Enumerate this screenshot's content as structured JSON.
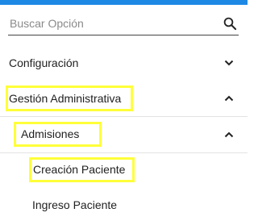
{
  "theme": {
    "accent": "#1e88e5",
    "highlight": "#ffff3a",
    "text": "#212121",
    "placeholder": "#8a8a8a"
  },
  "search": {
    "placeholder": "Buscar Opción",
    "value": "",
    "icon": "search-icon"
  },
  "menu": {
    "items": [
      {
        "label": "Configuración",
        "icon": "chevron-down-icon",
        "expanded": false
      },
      {
        "label": "Gestión Administrativa",
        "icon": "chevron-up-icon",
        "expanded": true
      },
      {
        "label": "Admisiones",
        "icon": "chevron-up-icon",
        "expanded": true
      },
      {
        "label": "Creación Paciente",
        "highlighted": true
      },
      {
        "label": "Ingreso Paciente"
      }
    ]
  }
}
